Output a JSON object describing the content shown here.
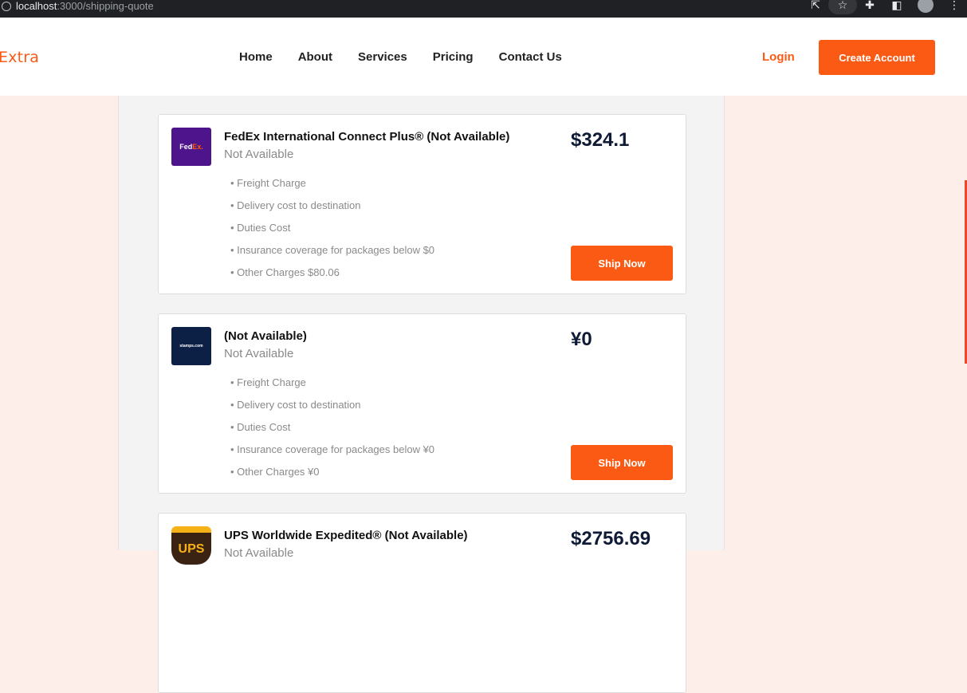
{
  "browser": {
    "url_host": "localhost",
    "url_rest": ":3000/shipping-quote"
  },
  "nav": {
    "brand": "Extra",
    "links": [
      "Home",
      "About",
      "Services",
      "Pricing",
      "Contact Us"
    ],
    "login": "Login",
    "create_account": "Create Account"
  },
  "colors": {
    "accent": "#fb5a14",
    "page_bg": "#fdeee9",
    "price_text": "#0e1a36"
  },
  "quotes": [
    {
      "logo": "fedex-logo",
      "logo_text_a": "Fed",
      "logo_text_b": "Ex.",
      "title": "FedEx International Connect Plus® (Not Available)",
      "status": "Not Available",
      "price": "$324.1",
      "charges": [
        "• Freight Charge",
        "• Delivery cost to destination",
        "• Duties Cost",
        "• Insurance coverage for packages below $0",
        "• Other Charges $80.06"
      ],
      "button": "Ship Now"
    },
    {
      "logo": "stamps-logo",
      "logo_text": "stamps.com",
      "title": "(Not Available)",
      "status": "Not Available",
      "price": "¥0",
      "charges": [
        "• Freight Charge",
        "• Delivery cost to destination",
        "• Duties Cost",
        "• Insurance coverage for packages below ¥0",
        "• Other Charges ¥0"
      ],
      "button": "Ship Now"
    },
    {
      "logo": "ups-logo",
      "logo_text": "UPS",
      "title": "UPS Worldwide Expedited® (Not Available)",
      "status": "Not Available",
      "price": "$2756.69"
    }
  ]
}
